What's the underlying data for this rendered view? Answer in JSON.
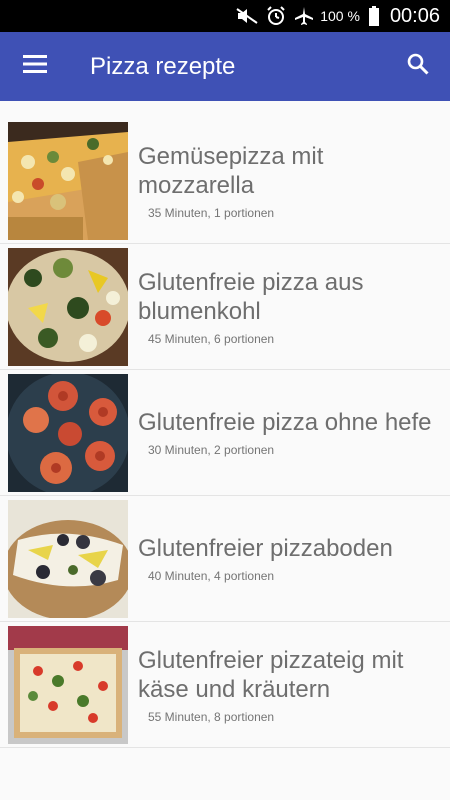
{
  "status_bar": {
    "battery": "100 %",
    "time": "00:06",
    "icons": [
      "mute-icon",
      "alarm-icon",
      "airplane-icon",
      "battery-icon"
    ]
  },
  "app_bar": {
    "title": "Pizza rezepte",
    "menu_icon": "menu-icon",
    "search_icon": "search-icon",
    "color": "#3f51b5"
  },
  "recipes": [
    {
      "title": "Gemüsepizza mit mozzarella",
      "meta": "35 Minuten, 1 portionen"
    },
    {
      "title": "Glutenfreie pizza aus blumenkohl",
      "meta": "45 Minuten, 6 portionen"
    },
    {
      "title": "Glutenfreie pizza ohne hefe",
      "meta": "30 Minuten, 2 portionen"
    },
    {
      "title": "Glutenfreier pizzaboden",
      "meta": "40 Minuten, 4 portionen"
    },
    {
      "title": "Glutenfreier pizzateig mit käse und kräutern",
      "meta": "55 Minuten, 8 portionen"
    }
  ]
}
